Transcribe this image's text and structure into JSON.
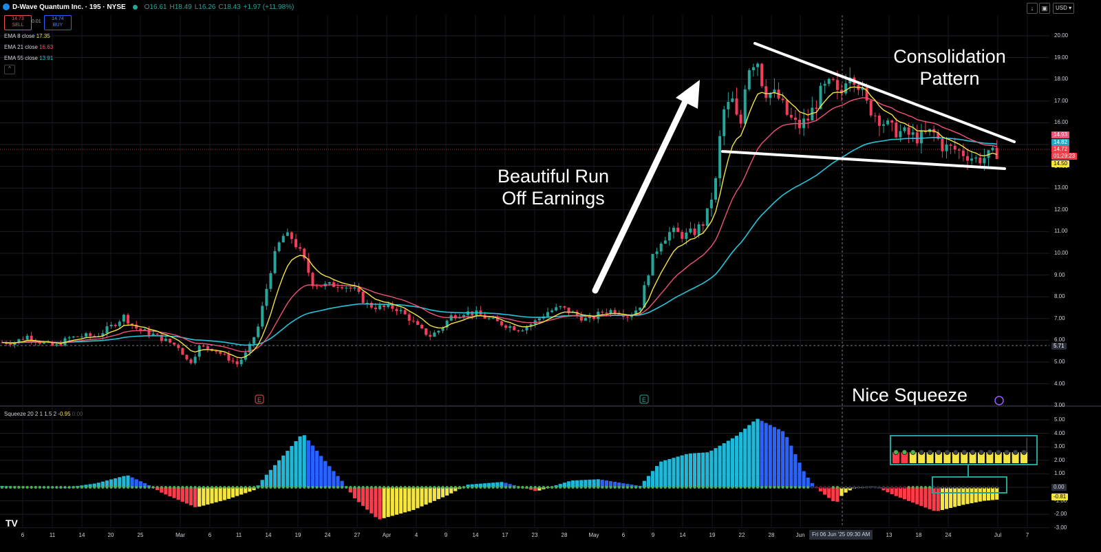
{
  "header": {
    "title": "D-Wave Quantum Inc. · 195 · NYSE",
    "open_label": "O",
    "open": "16.61",
    "high_label": "H",
    "high": "18.49",
    "low_label": "L",
    "low": "16.26",
    "close_label": "C",
    "close": "18.43",
    "change": "+1.97 (+11.98%)"
  },
  "trade": {
    "sell_price": "14.73",
    "sell_label": "SELL",
    "spread": "0.01",
    "buy_price": "14.74",
    "buy_label": "BUY"
  },
  "indicators": [
    {
      "label": "EMA 8 close",
      "value": "17.35",
      "color": "#f5e543"
    },
    {
      "label": "EMA 21 close",
      "value": "16.63",
      "color": "#ef5378"
    },
    {
      "label": "EMA 55 close",
      "value": "13.91",
      "color": "#26c6da"
    }
  ],
  "squeeze": {
    "label": "Squeeze 20 2 1 1.5 2",
    "value": "-0.95",
    "value2": "0.00"
  },
  "toolbar": {
    "currency": "USD"
  },
  "price_axis": [
    "20.00",
    "19.00",
    "18.00",
    "17.00",
    "16.00",
    "15.00",
    "14.00",
    "13.00",
    "12.00",
    "11.00",
    "10.00",
    "9.00",
    "8.00",
    "7.00",
    "6.00",
    "5.00",
    "4.00",
    "3.00"
  ],
  "price_tags": [
    {
      "value": "14.93",
      "color": "#ef5378"
    },
    {
      "value": "14.82",
      "color": "#26a6c6"
    },
    {
      "value": "14.72",
      "color": "#ef3d4a"
    },
    {
      "value": "01:29:23",
      "color": "#ef3d4a"
    },
    {
      "value": "14.50",
      "color": "#f5e543"
    },
    {
      "value": "5.71",
      "color": "#2a2e39"
    }
  ],
  "osc_axis": [
    "5.00",
    "4.00",
    "3.00",
    "2.00",
    "1.00",
    "0.00",
    "-1.00",
    "-2.00",
    "-3.00"
  ],
  "osc_tags": [
    {
      "value": "0.00"
    },
    {
      "value": "-0.81"
    }
  ],
  "x_axis": [
    "6",
    "11",
    "14",
    "20",
    "25",
    "Mar",
    "6",
    "11",
    "14",
    "19",
    "24",
    "27",
    "Apr",
    "4",
    "9",
    "14",
    "17",
    "23",
    "28",
    "May",
    "6",
    "9",
    "14",
    "19",
    "22",
    "28",
    "Jun",
    "13",
    "18",
    "24",
    "Jul",
    "7"
  ],
  "crosshair_date": "Fri 06 Jun '25   09:30 AM",
  "annotations": {
    "run": "Beautiful Run\nOff Earnings",
    "consolidation": "Consolidation\nPattern",
    "squeeze": "Nice Squeeze"
  },
  "earnings_markers": [
    "E",
    "E"
  ],
  "logo": "TV"
}
